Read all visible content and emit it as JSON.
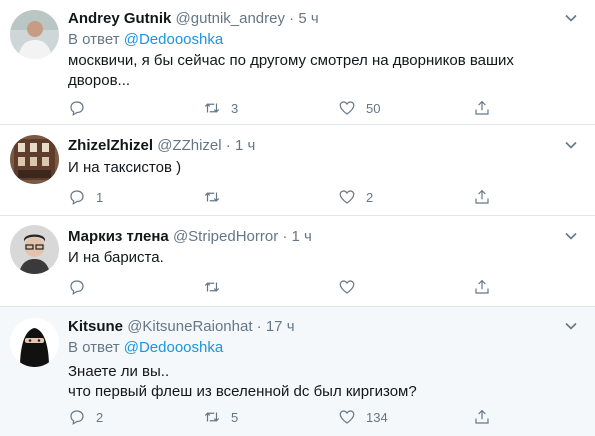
{
  "tweets": [
    {
      "name": "Andrey Gutnik",
      "handle": "@gutnik_andrey",
      "dot": "·",
      "time": "5 ч",
      "reply_prefix": "В ответ",
      "reply_to": "@Dedoooshka",
      "text_lines": [
        "москвичи, я бы сейчас по другому смотрел на дворников ваших",
        "дворов..."
      ],
      "reply_count": "",
      "retweet_count": "3",
      "like_count": "50",
      "avatar": "man-white-shirt-photo"
    },
    {
      "name": "ZhizelZhizel",
      "handle": "@ZZhizel",
      "dot": "·",
      "time": "1 ч",
      "text_lines": [
        "И на таксистов )"
      ],
      "reply_count": "1",
      "retweet_count": "",
      "like_count": "2",
      "avatar": "building-photo"
    },
    {
      "name": "Маркиз тлена",
      "handle": "@StripedHorror",
      "dot": "·",
      "time": "1 ч",
      "text_lines": [
        "И на бариста."
      ],
      "reply_count": "",
      "retweet_count": "",
      "like_count": "",
      "avatar": "man-glasses-photo"
    },
    {
      "name": "Kitsune",
      "handle": "@KitsuneRaionhat",
      "dot": "·",
      "time": "17 ч",
      "reply_prefix": "В ответ",
      "reply_to": "@Dedoooshka",
      "text_lines": [
        "Знаете ли вы..",
        "что первый флеш из вселенной dc был киргизом?"
      ],
      "reply_count": "2",
      "retweet_count": "5",
      "like_count": "134",
      "avatar": "masked-figure-photo"
    }
  ],
  "colors": {
    "link": "#1b95e0",
    "muted": "#657786",
    "divider": "#e1e8ed",
    "highlight_bg": "#f5f8fa"
  }
}
